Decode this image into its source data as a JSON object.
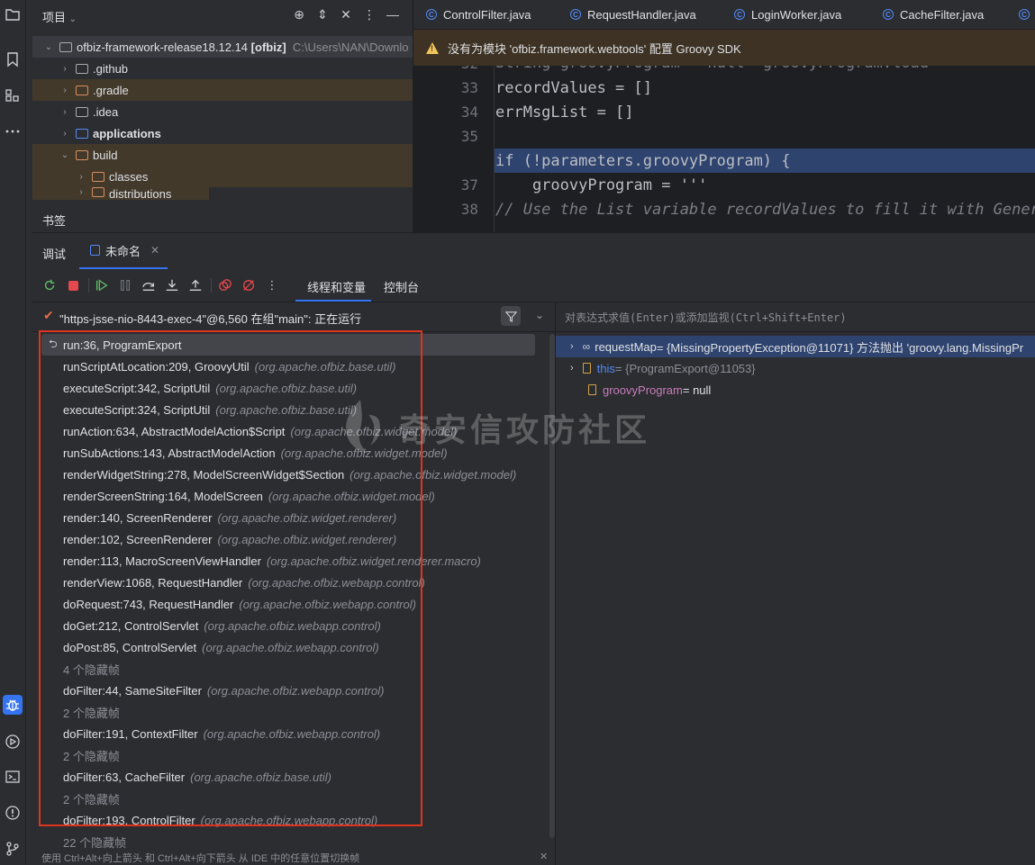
{
  "project": {
    "title": "项目",
    "root_name": "ofbiz-framework-release18.12.14",
    "root_module": "[ofbiz]",
    "root_path": "C:\\Users\\NAN\\Downlo",
    "items": [
      {
        "label": ".github"
      },
      {
        "label": ".gradle"
      },
      {
        "label": ".idea"
      },
      {
        "label": "applications"
      },
      {
        "label": "build"
      },
      {
        "label": "classes"
      },
      {
        "label": "distributions"
      }
    ]
  },
  "bookmarks": {
    "title": "书签"
  },
  "editor": {
    "tabs": [
      "ControlFilter.java",
      "RequestHandler.java",
      "LoginWorker.java",
      "CacheFilter.java"
    ],
    "warning": "没有为模块 'ofbiz.framework.webtools' 配置 Groovy SDK",
    "lines": [
      {
        "num": "32",
        "text": "String groovyProgram = null  groovyProgram.load"
      },
      {
        "num": "33",
        "text": "recordValues = []"
      },
      {
        "num": "34",
        "text": "errMsgList = []"
      },
      {
        "num": "35",
        "text": ""
      },
      {
        "num": "",
        "text": "if (!parameters.groovyProgram) {"
      },
      {
        "num": "37",
        "text": "    groovyProgram = '''"
      },
      {
        "num": "38",
        "text": "// Use the List variable recordValues to fill it with Generic"
      }
    ]
  },
  "debug": {
    "tab_debug": "调试",
    "tab_session": "未命名",
    "subtab_threads": "线程和变量",
    "subtab_console": "控制台",
    "thread": "\"https-jsse-nio-8443-exec-4\"@6,560 在组\"main\": 正在运行",
    "frames": [
      {
        "name": "run:36, ProgramExport",
        "pkg": ""
      },
      {
        "name": "runScriptAtLocation:209, GroovyUtil",
        "pkg": "(org.apache.ofbiz.base.util)"
      },
      {
        "name": "executeScript:342, ScriptUtil",
        "pkg": "(org.apache.ofbiz.base.util)"
      },
      {
        "name": "executeScript:324, ScriptUtil",
        "pkg": "(org.apache.ofbiz.base.util)"
      },
      {
        "name": "runAction:634, AbstractModelAction$Script",
        "pkg": "(org.apache.ofbiz.widget.model)"
      },
      {
        "name": "runSubActions:143, AbstractModelAction",
        "pkg": "(org.apache.ofbiz.widget.model)"
      },
      {
        "name": "renderWidgetString:278, ModelScreenWidget$Section",
        "pkg": "(org.apache.ofbiz.widget.model)"
      },
      {
        "name": "renderScreenString:164, ModelScreen",
        "pkg": "(org.apache.ofbiz.widget.model)"
      },
      {
        "name": "render:140, ScreenRenderer",
        "pkg": "(org.apache.ofbiz.widget.renderer)"
      },
      {
        "name": "render:102, ScreenRenderer",
        "pkg": "(org.apache.ofbiz.widget.renderer)"
      },
      {
        "name": "render:113, MacroScreenViewHandler",
        "pkg": "(org.apache.ofbiz.widget.renderer.macro)"
      },
      {
        "name": "renderView:1068, RequestHandler",
        "pkg": "(org.apache.ofbiz.webapp.control)"
      },
      {
        "name": "doRequest:743, RequestHandler",
        "pkg": "(org.apache.ofbiz.webapp.control)"
      },
      {
        "name": "doGet:212, ControlServlet",
        "pkg": "(org.apache.ofbiz.webapp.control)"
      },
      {
        "name": "doPost:85, ControlServlet",
        "pkg": "(org.apache.ofbiz.webapp.control)"
      },
      {
        "name": "4 个隐藏帧",
        "pkg": ""
      },
      {
        "name": "doFilter:44, SameSiteFilter",
        "pkg": "(org.apache.ofbiz.webapp.control)"
      },
      {
        "name": "2 个隐藏帧",
        "pkg": ""
      },
      {
        "name": "doFilter:191, ContextFilter",
        "pkg": "(org.apache.ofbiz.webapp.control)"
      },
      {
        "name": "2 个隐藏帧",
        "pkg": ""
      },
      {
        "name": "doFilter:63, CacheFilter",
        "pkg": "(org.apache.ofbiz.base.util)"
      },
      {
        "name": "2 个隐藏帧",
        "pkg": ""
      },
      {
        "name": "doFilter:193, ControlFilter",
        "pkg": "(org.apache.ofbiz.webapp.control)"
      },
      {
        "name": "22 个隐藏帧",
        "pkg": ""
      }
    ],
    "footer_hint": "使用 Ctrl+Alt+向上箭头 和 Ctrl+Alt+向下箭头 从 IDE 中的任意位置切换帧",
    "eval_placeholder": "对表达式求值(Enter)或添加监视(Ctrl+Shift+Enter)",
    "vars": [
      {
        "name": "requestMap",
        "value": " = {MissingPropertyException@11071} 方法抛出 'groovy.lang.MissingPr"
      },
      {
        "name": "this",
        "value": " = {ProgramExport@11053}"
      },
      {
        "name": "groovyProgram",
        "value": " = null"
      }
    ]
  },
  "watermark": {
    "text": "奇安信攻防社区"
  },
  "colors": {
    "accent": "#3574f0",
    "highlight_box": "#e0331f",
    "warning_bg": "#3d3223",
    "breakpoint": "#e5484d"
  }
}
